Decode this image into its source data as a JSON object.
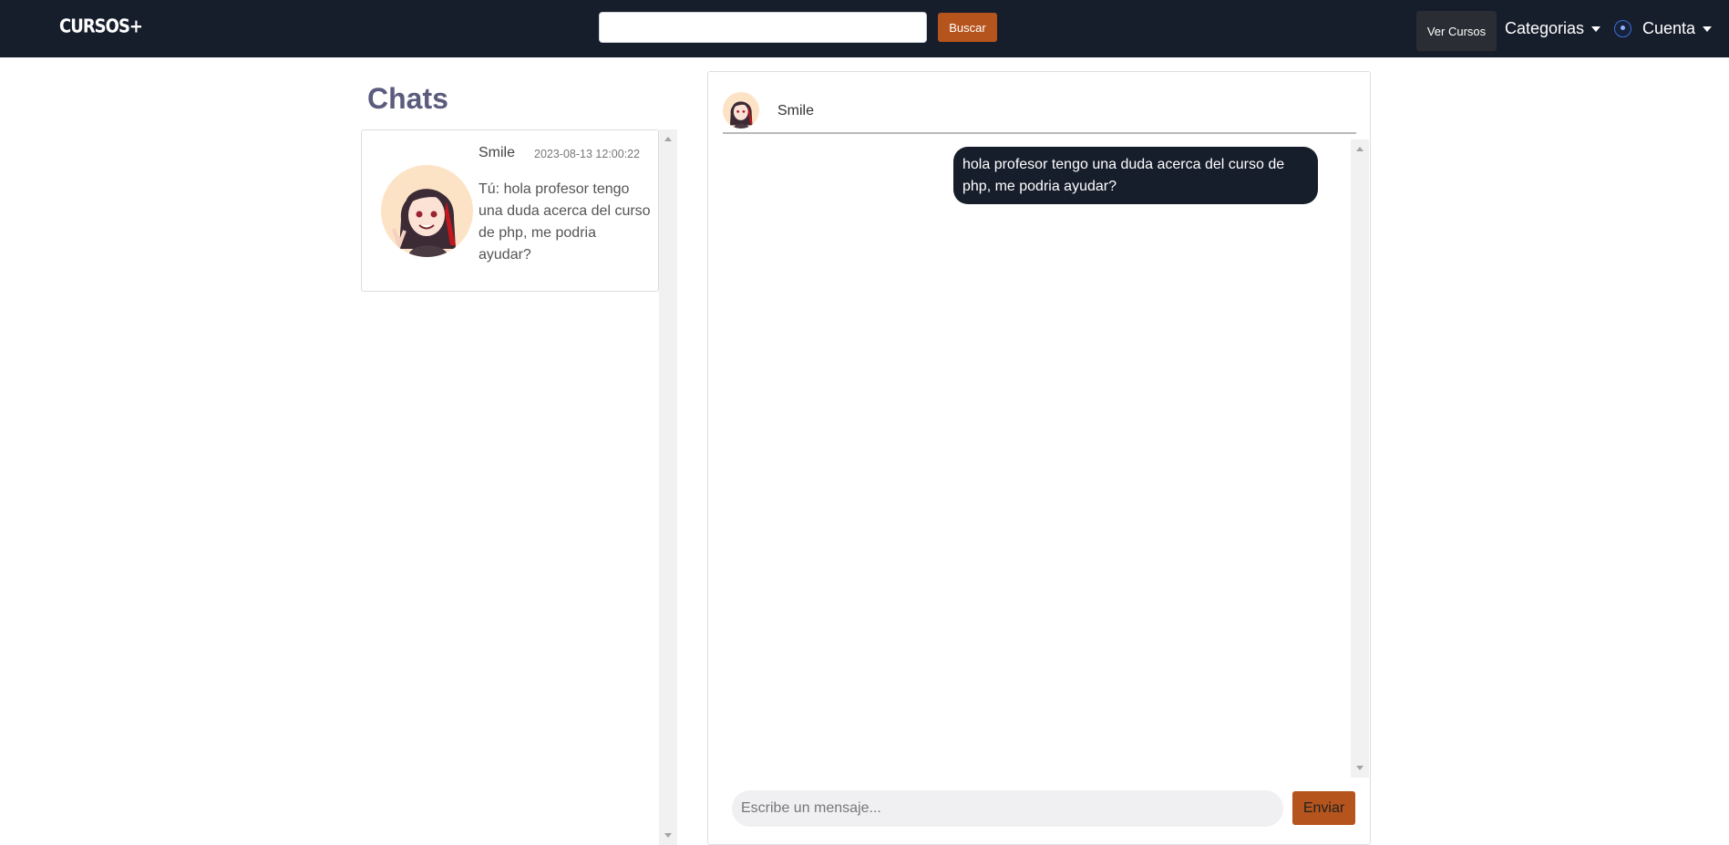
{
  "navbar": {
    "brand": "CURSOS+",
    "search": {
      "value": "",
      "placeholder": ""
    },
    "search_button": "Buscar",
    "ver_cursos": "Ver Cursos",
    "categorias": "Categorias",
    "cuenta": "Cuenta"
  },
  "sidebar": {
    "title": "Chats",
    "chats": [
      {
        "name": "Smile",
        "time": "2023-08-13 12:00:22",
        "last_message": "Tú: hola profesor tengo una duda acerca del curso de php, me podria ayudar?"
      }
    ]
  },
  "conversation": {
    "contact_name": "Smile",
    "messages": [
      {
        "from": "me",
        "text": "hola profesor tengo una duda acerca del curso de php, me podria ayudar?"
      }
    ],
    "composer": {
      "placeholder": "Escribe un mensaje...",
      "value": ""
    },
    "send_button": "Enviar"
  },
  "colors": {
    "navbar_bg": "#161d2b",
    "accent": "#b5541c",
    "bubble_bg": "#161d2b",
    "title": "#5b5b7e"
  }
}
